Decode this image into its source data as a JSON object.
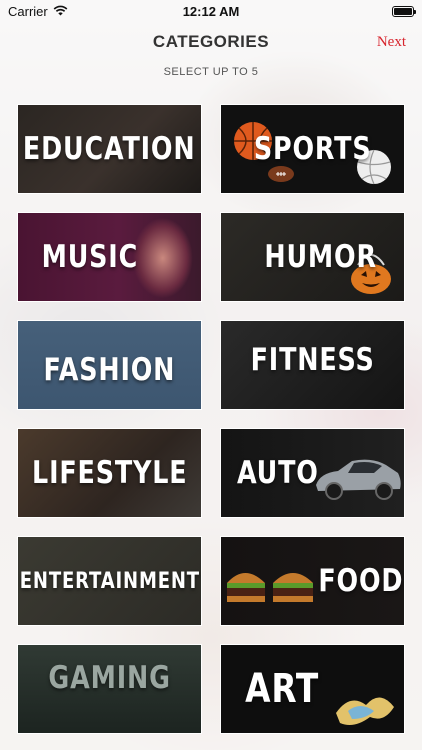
{
  "status_bar": {
    "carrier": "Carrier",
    "time": "12:12 AM"
  },
  "nav": {
    "title": "CATEGORIES",
    "next_label": "Next",
    "next_color": "#d7242d"
  },
  "subtitle": "SELECT UP TO 5",
  "categories": [
    {
      "label": "EDUCATION"
    },
    {
      "label": "SPORTS"
    },
    {
      "label": "MUSIC"
    },
    {
      "label": "HUMOR"
    },
    {
      "label": "FASHION"
    },
    {
      "label": "FITNESS"
    },
    {
      "label": "LIFESTYLE"
    },
    {
      "label": "AUTO"
    },
    {
      "label": "ENTERTAINMENT"
    },
    {
      "label": "FOOD"
    },
    {
      "label": "GAMING"
    },
    {
      "label": "ART"
    }
  ]
}
